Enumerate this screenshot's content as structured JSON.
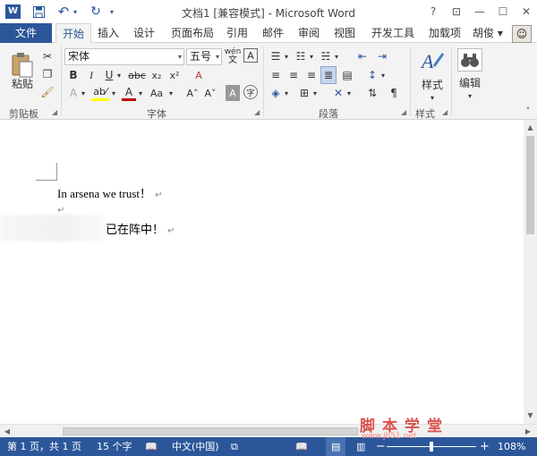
{
  "title_bar": {
    "app_logo": "W",
    "title": "文档1 [兼容模式] - Microsoft Word",
    "help": "?",
    "ribbon_display": "⊡",
    "minimize": "—",
    "restore": "☐",
    "close": "✕"
  },
  "tabs": {
    "file": "文件",
    "items": [
      "开始",
      "插入",
      "设计",
      "页面布局",
      "引用",
      "邮件",
      "审阅",
      "视图",
      "开发工具",
      "加载项"
    ],
    "user": "胡俊 ▾"
  },
  "ribbon": {
    "clipboard": {
      "paste": "粘贴",
      "label": "剪贴板"
    },
    "font": {
      "font_name": "宋体",
      "font_size": "五号",
      "wen": "wén",
      "label": "字体",
      "bold": "B",
      "italic": "I",
      "underline": "U",
      "strike": "abc",
      "subscript": "x₂",
      "superscript": "x²",
      "text_effect": "A",
      "highlight": "ab⁄",
      "font_color": "A",
      "change_case": "Aa",
      "grow": "A˄",
      "shrink": "A˅",
      "shade": "A",
      "enclose": "字",
      "clear": "A"
    },
    "paragraph": {
      "label": "段落"
    },
    "styles": {
      "button": "样式",
      "label": "样式"
    },
    "editing": {
      "button": "编辑"
    }
  },
  "document": {
    "line1": "In arsena we trust！",
    "line2": "已在阵中！"
  },
  "status": {
    "page": "第 1 页，共 1 页",
    "words": "15 个字",
    "language": "中文(中国)",
    "zoom": "108%",
    "zoom_minus": "−",
    "zoom_plus": "+"
  },
  "watermark": {
    "text": "脚本学堂",
    "url": "www.jb51.net"
  }
}
